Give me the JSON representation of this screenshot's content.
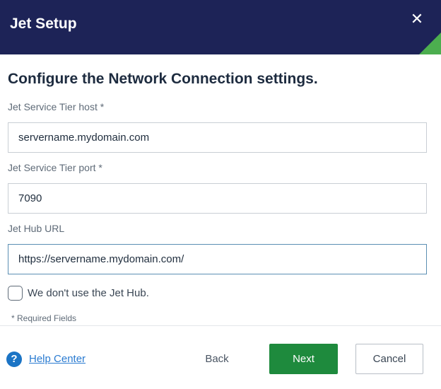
{
  "dialog": {
    "title": "Jet Setup",
    "close_glyph": "✕",
    "heading": "Configure the Network Connection settings."
  },
  "form": {
    "host": {
      "label": "Jet Service Tier host *",
      "value": "servername.mydomain.com"
    },
    "port": {
      "label": "Jet Service Tier port *",
      "value": "7090"
    },
    "hub_url": {
      "label": "Jet Hub URL",
      "value": "https://servername.mydomain.com/"
    },
    "no_hub": {
      "label": "We don't use the Jet Hub.",
      "checked": false
    },
    "required_note": "* Required Fields"
  },
  "footer": {
    "help_icon_glyph": "?",
    "help_label": "Help Center",
    "back_label": "Back",
    "next_label": "Next",
    "cancel_label": "Cancel"
  },
  "colors": {
    "header_bg": "#1d2357",
    "accent_green": "#4cae4f",
    "primary_button": "#1e8a3d",
    "link": "#2a7bd1",
    "help_icon": "#1b74c5"
  },
  "icons": {
    "close": "close-icon",
    "help": "question-circle-icon"
  }
}
